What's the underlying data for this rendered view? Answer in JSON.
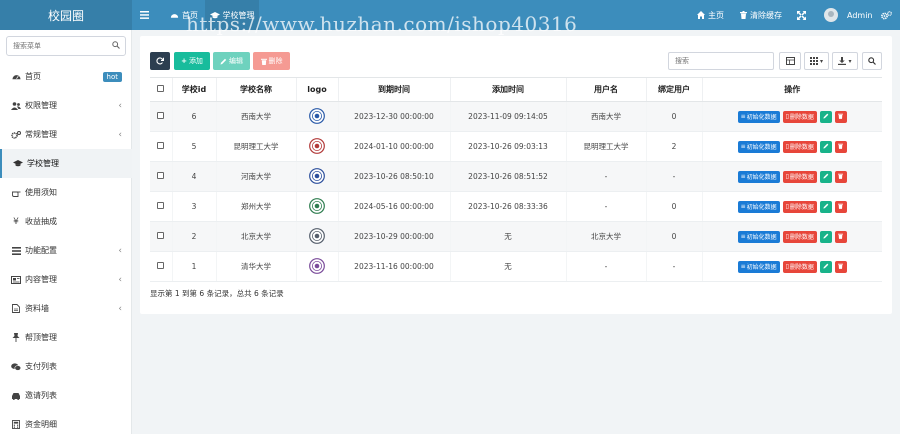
{
  "app": {
    "logo_text": "校园圈"
  },
  "topbar": {
    "home_label": "首页",
    "active_tab_label": "学校管理",
    "watermark": "https://www.huzhan.com/ishop40316",
    "right_home_label": "主页",
    "clear_cache_label": "清除缓存",
    "user_name": "Admin"
  },
  "sidebar": {
    "search_placeholder": "搜索菜单",
    "items": [
      {
        "label": "首页",
        "icon": "dashboard-icon",
        "badge": "hot",
        "has_submenu": false
      },
      {
        "label": "权限管理",
        "icon": "users-icon",
        "has_submenu": true
      },
      {
        "label": "常规管理",
        "icon": "cogs-icon",
        "has_submenu": true
      },
      {
        "label": "学校管理",
        "icon": "graduation-cap-icon",
        "has_submenu": false,
        "active": true
      },
      {
        "label": "使用须知",
        "icon": "hand-icon",
        "has_submenu": false
      },
      {
        "label": "收益抽成",
        "icon": "yen-icon",
        "has_submenu": false
      },
      {
        "label": "功能配置",
        "icon": "list-icon",
        "has_submenu": true
      },
      {
        "label": "内容管理",
        "icon": "newspaper-icon",
        "has_submenu": true
      },
      {
        "label": "资料墙",
        "icon": "file-icon",
        "has_submenu": true
      },
      {
        "label": "帮顶管理",
        "icon": "pin-icon",
        "has_submenu": false
      },
      {
        "label": "支付列表",
        "icon": "wechat-icon",
        "has_submenu": false
      },
      {
        "label": "邀请列表",
        "icon": "car-icon",
        "has_submenu": false
      },
      {
        "label": "资金明细",
        "icon": "calculator-icon",
        "has_submenu": false
      }
    ]
  },
  "toolbar": {
    "add_label": "添加",
    "edit_label": "编辑",
    "delete_label": "删除",
    "search_placeholder": "搜索"
  },
  "table": {
    "headers": [
      "学校id",
      "学校名称",
      "logo",
      "到期时间",
      "添加时间",
      "用户名",
      "绑定用户",
      "操作"
    ],
    "rows": [
      {
        "id": "6",
        "name": "西南大学",
        "logo": "西南大学",
        "expire": "2023-12-30 00:00:00",
        "added": "2023-11-09 09:14:05",
        "user": "西南大学",
        "bound": "0"
      },
      {
        "id": "5",
        "name": "昆明理工大学",
        "logo": "昆明理工大学",
        "expire": "2024-01-10 00:00:00",
        "added": "2023-10-26 09:03:13",
        "user": "昆明理工大学",
        "bound": "2"
      },
      {
        "id": "4",
        "name": "河南大学",
        "logo": "河南大学",
        "expire": "2023-10-26 08:50:10",
        "added": "2023-10-26 08:51:52",
        "user": "-",
        "bound": "-"
      },
      {
        "id": "3",
        "name": "郑州大学",
        "logo": "郑州大学",
        "expire": "2024-05-16 00:00:00",
        "added": "2023-10-26 08:33:36",
        "user": "-",
        "bound": "0"
      },
      {
        "id": "2",
        "name": "北京大学",
        "logo": "北京大学",
        "expire": "2023-10-29 00:00:00",
        "added": "无",
        "user": "北京大学",
        "bound": "0"
      },
      {
        "id": "1",
        "name": "清华大学",
        "logo": "清华大学",
        "expire": "2023-11-16 00:00:00",
        "added": "无",
        "user": "-",
        "bound": "-"
      }
    ],
    "op_init_label": "初始化数据",
    "op_delete_data_label": "删除数据"
  },
  "footer": {
    "summary": "显示第 1 到第 6 条记录，总共 6 条记录"
  },
  "colors": {
    "topbar": "#3c8dbc",
    "add": "#18bc9c",
    "edit": "#6ed2be",
    "delete": "#f59a93",
    "refresh": "#2c3e50",
    "op_blue": "#1a7bd6",
    "op_red": "#e7463a",
    "op_green": "#18b38a"
  }
}
